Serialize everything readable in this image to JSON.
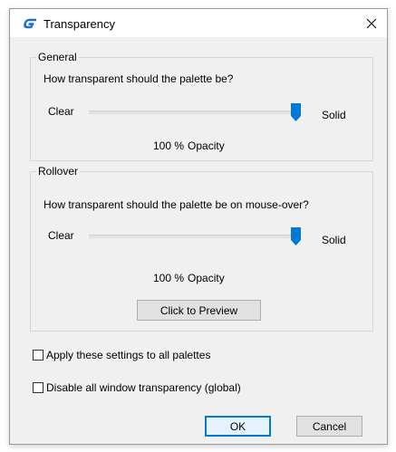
{
  "window": {
    "title": "Transparency",
    "app_icon": "G-logo-icon",
    "close_label": "✕"
  },
  "general": {
    "legend": "General",
    "prompt": "How transparent should the palette be?",
    "left_label": "Clear",
    "right_label": "Solid",
    "slider_value_percent": 100,
    "opacity_value": "100 %",
    "opacity_label": "Opacity"
  },
  "rollover": {
    "legend": "Rollover",
    "prompt": "How transparent should the palette be on mouse-over?",
    "left_label": "Clear",
    "right_label": "Solid",
    "slider_value_percent": 100,
    "opacity_value": "100 %",
    "opacity_label": "Opacity",
    "preview_button": "Click to Preview"
  },
  "options": {
    "apply_all_label": "Apply these settings to all palettes",
    "apply_all_checked": false,
    "disable_all_label": "Disable all window transparency (global)",
    "disable_all_checked": false
  },
  "buttons": {
    "ok": "OK",
    "cancel": "Cancel"
  },
  "colors": {
    "accent": "#1f6fd1",
    "dialog_bg": "#f0f0f0",
    "default_button_border": "#0078d7"
  }
}
